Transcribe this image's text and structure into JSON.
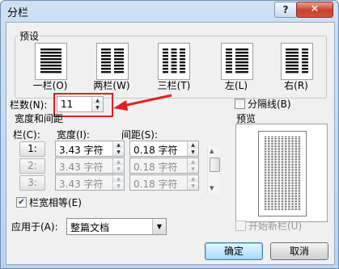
{
  "window": {
    "title": "分栏",
    "help_glyph": "?",
    "close_glyph": "✕"
  },
  "presets": {
    "group_label": "预设",
    "items": [
      {
        "label": "一栏(O)",
        "icon": "one-column-icon"
      },
      {
        "label": "两栏(W)",
        "icon": "two-columns-icon"
      },
      {
        "label": "三栏(T)",
        "icon": "three-columns-icon"
      },
      {
        "label": "左(L)",
        "icon": "left-column-icon"
      },
      {
        "label": "右(R)",
        "icon": "right-column-icon"
      }
    ]
  },
  "column_count": {
    "label": "栏数(N):",
    "value": "11"
  },
  "separator": {
    "label": "分隔线(B)",
    "checked": false
  },
  "width_spacing": {
    "section_label": "宽度和间距",
    "headers": {
      "col": "栏(C):",
      "width": "宽度(I):",
      "spacing": "间距(S):"
    },
    "rows": [
      {
        "col": "1:",
        "width": "3.43 字符",
        "spacing": "0.18 字符",
        "enabled": true
      },
      {
        "col": "2:",
        "width": "3.43 字符",
        "spacing": "0.18 字符",
        "enabled": false
      },
      {
        "col": "3:",
        "width": "3.43 字符",
        "spacing": "0.18 字符",
        "enabled": false
      }
    ]
  },
  "equal_width": {
    "label": "栏宽相等(E)",
    "checked": true
  },
  "preview": {
    "label": "预览",
    "columns": 11
  },
  "apply_to": {
    "label": "应用于(A):",
    "value": "整篇文档"
  },
  "new_column": {
    "label": "开始新栏(U)",
    "checked": false,
    "enabled": false
  },
  "buttons": {
    "ok": "确定",
    "cancel": "取消"
  },
  "colors": {
    "annotation": "#e02020",
    "window_frame": "#bcd3ee",
    "dialog_bg": "#f0f0f0"
  }
}
